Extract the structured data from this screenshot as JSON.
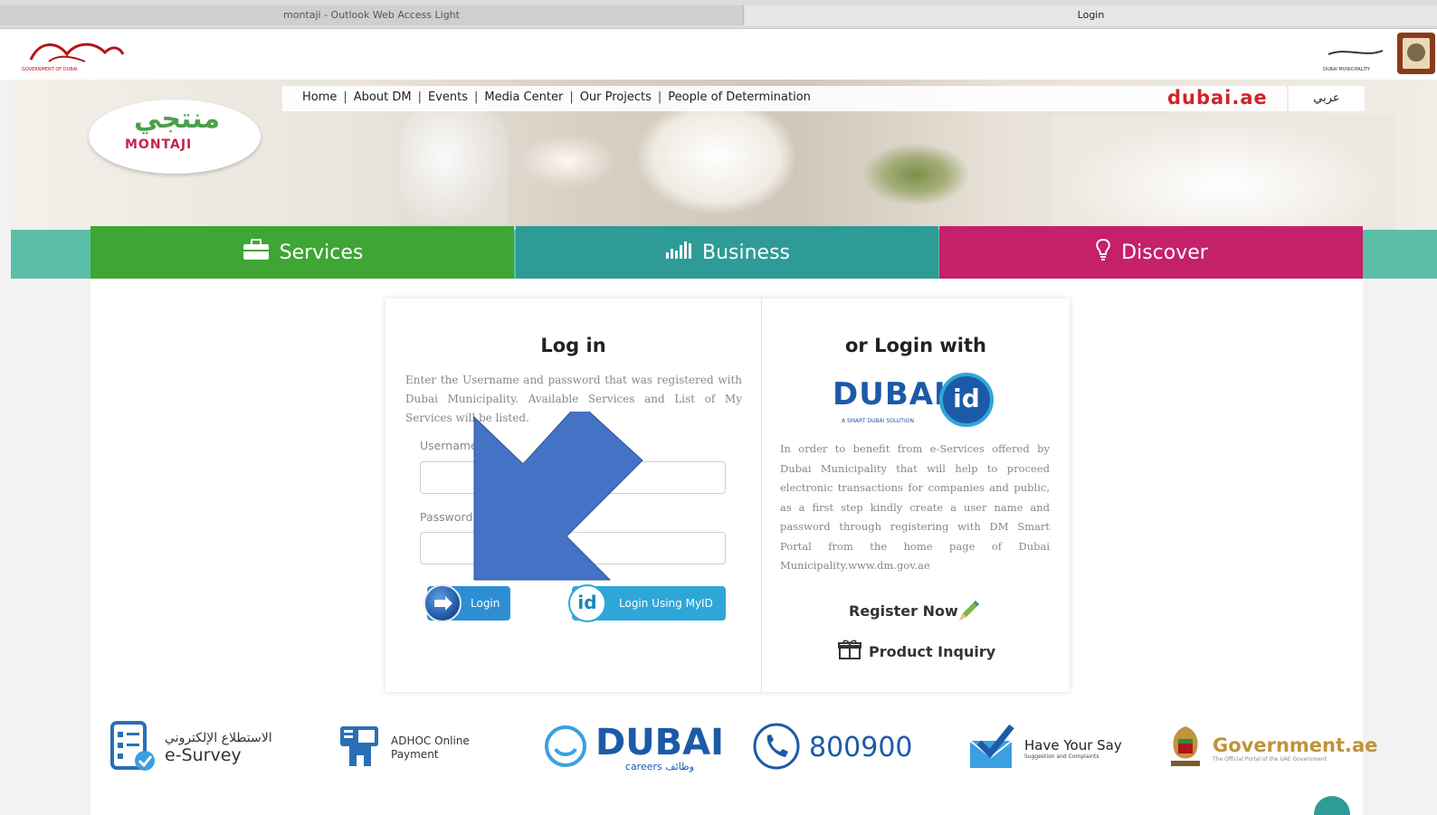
{
  "browser": {
    "tab1_title": "montaji - Outlook Web Access Light",
    "tab2_title": "Login"
  },
  "header": {
    "gov_logo_text": "GOVERNMENT OF DUBAI",
    "dm_logo_text": "DUBAI MUNICIPALITY"
  },
  "nav": {
    "items": [
      "Home",
      "About DM",
      "Events",
      "Media Center",
      "Our Projects",
      "People of Determination"
    ],
    "dubai_ae": "dubai.ae",
    "arabic": "عربي"
  },
  "montaji": {
    "logo_text": "MONTAJI",
    "logo_arabic": "منتجي"
  },
  "main_tabs": {
    "services": "Services",
    "business": "Business",
    "discover": "Discover"
  },
  "login": {
    "title": "Log in",
    "description": "Enter the Username and password that was registered with Dubai Municipality. Available Services and List of My Services will be listed.",
    "username_label": "Username",
    "password_label": "Password",
    "login_button": "Login",
    "myid_button": "Login Using MyID"
  },
  "alt_login": {
    "title": "or Login with",
    "dubai_id_text": "DUBAI",
    "dubai_id_badge": "id",
    "dubai_id_sub": "A SMART DUBAI SOLUTION",
    "description": "In order to benefit from e-Services offered by Dubai Municipality that will help to proceed electronic transactions for companies and public, as a first step kindly create a user name and password through registering with DM Smart Portal from the home page of Dubai Municipality.www.dm.gov.ae",
    "register": "Register Now",
    "inquiry": "Product Inquiry"
  },
  "footer": {
    "esurvey_ar": "الاستطلاع الإلكتروني",
    "esurvey_en": "e-Survey",
    "adhoc_line1": "ADHOC Online",
    "adhoc_line2": "Payment",
    "careers_big": "DUBAI",
    "careers_sub": "careers وظائف",
    "phone": "800900",
    "say_title": "Have Your Say",
    "say_sub": "Suggestion and Complaints",
    "gov_title": "Government.ae",
    "gov_sub": "The Official Portal of the UAE Government"
  },
  "colors": {
    "services": "#3fa535",
    "business": "#2e9b97",
    "discover": "#c5206a",
    "arrow": "#4472c4"
  }
}
